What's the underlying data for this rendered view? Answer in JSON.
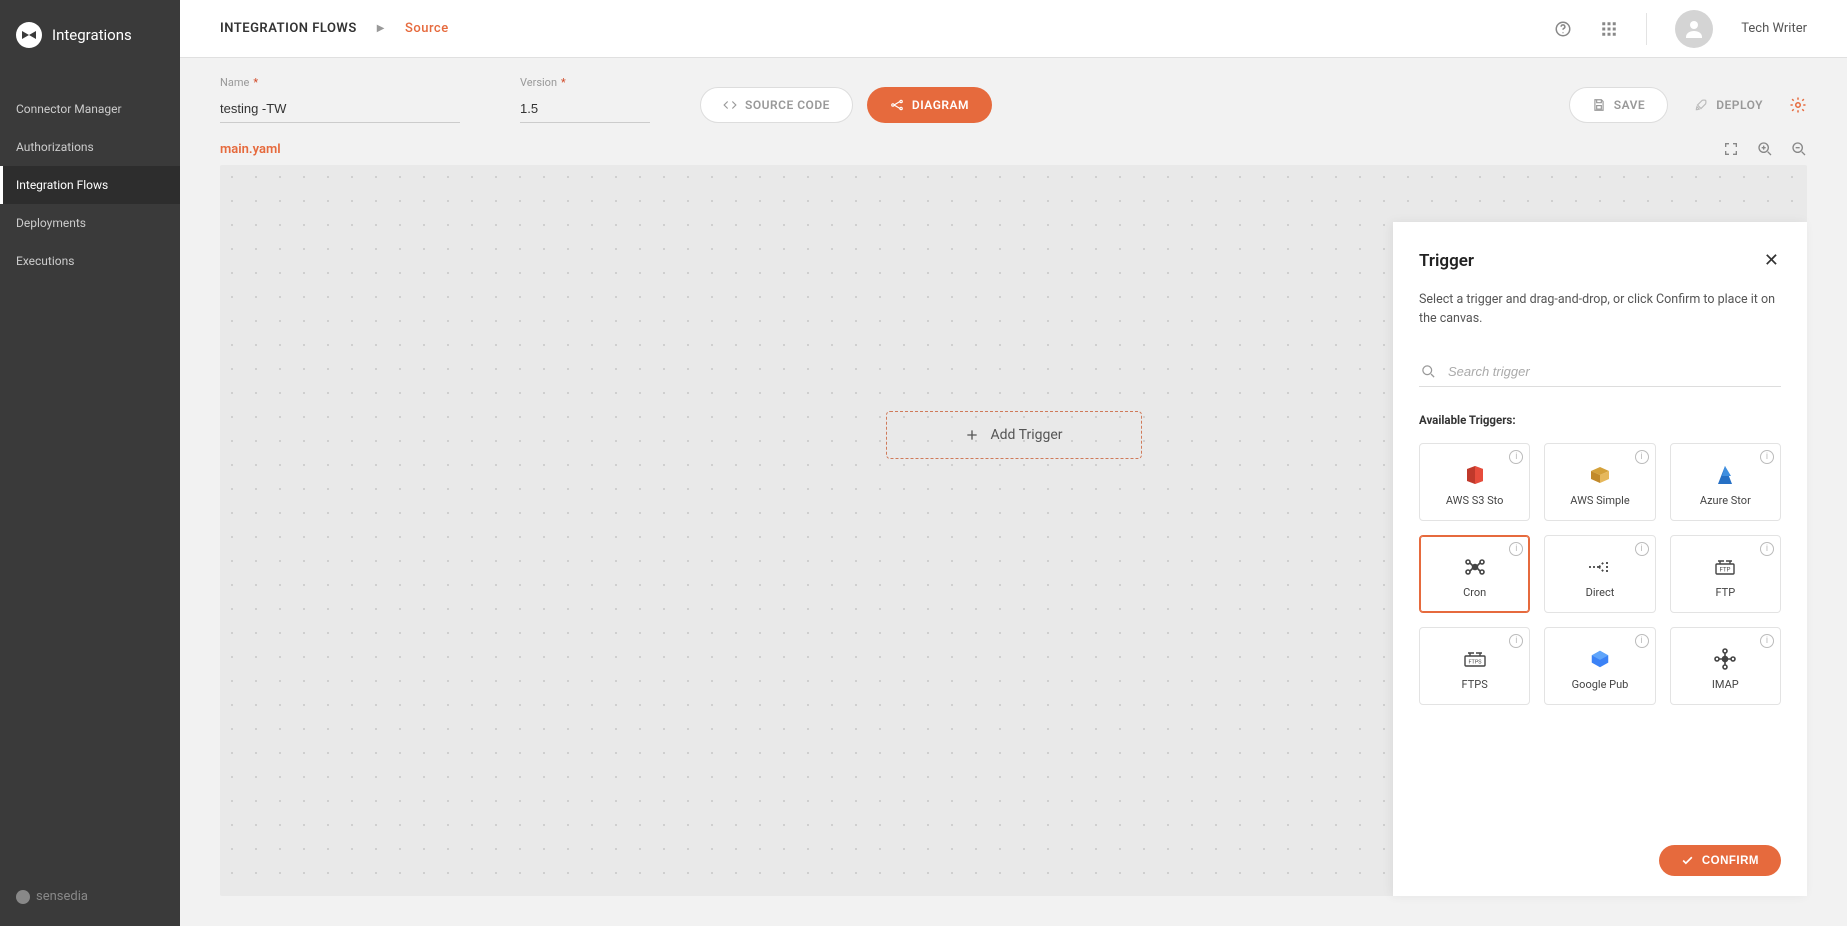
{
  "brand": {
    "name": "Integrations"
  },
  "sidebar": {
    "items": [
      {
        "label": "Connector Manager"
      },
      {
        "label": "Authorizations"
      },
      {
        "label": "Integration Flows"
      },
      {
        "label": "Deployments"
      },
      {
        "label": "Executions"
      }
    ],
    "footer": "sensedia"
  },
  "breadcrumb": {
    "root": "INTEGRATION FLOWS",
    "leaf": "Source"
  },
  "user": {
    "name": "Tech Writer"
  },
  "form": {
    "name_label": "Name",
    "name_value": "testing -TW",
    "version_label": "Version",
    "version_value": "1.5"
  },
  "toolbar": {
    "source_label": "SOURCE CODE",
    "diagram_label": "DIAGRAM",
    "save_label": "SAVE",
    "deploy_label": "DEPLOY"
  },
  "file": {
    "name": "main.yaml"
  },
  "canvas": {
    "add_trigger_label": "Add Trigger"
  },
  "panel": {
    "title": "Trigger",
    "description": "Select a trigger and drag-and-drop, or click Confirm to place it on the canvas.",
    "search_placeholder": "Search trigger",
    "section_label": "Available Triggers:",
    "confirm_label": "CONFIRM",
    "triggers": [
      {
        "label": "AWS S3 Sto",
        "icon": "aws-s3"
      },
      {
        "label": "AWS Simple",
        "icon": "aws-box"
      },
      {
        "label": "Azure Stor",
        "icon": "azure"
      },
      {
        "label": "Cron",
        "icon": "cron",
        "selected": true
      },
      {
        "label": "Direct",
        "icon": "direct"
      },
      {
        "label": "FTP",
        "icon": "ftp"
      },
      {
        "label": "FTPS",
        "icon": "ftps"
      },
      {
        "label": "Google Pub",
        "icon": "gcp"
      },
      {
        "label": "IMAP",
        "icon": "imap"
      }
    ]
  }
}
